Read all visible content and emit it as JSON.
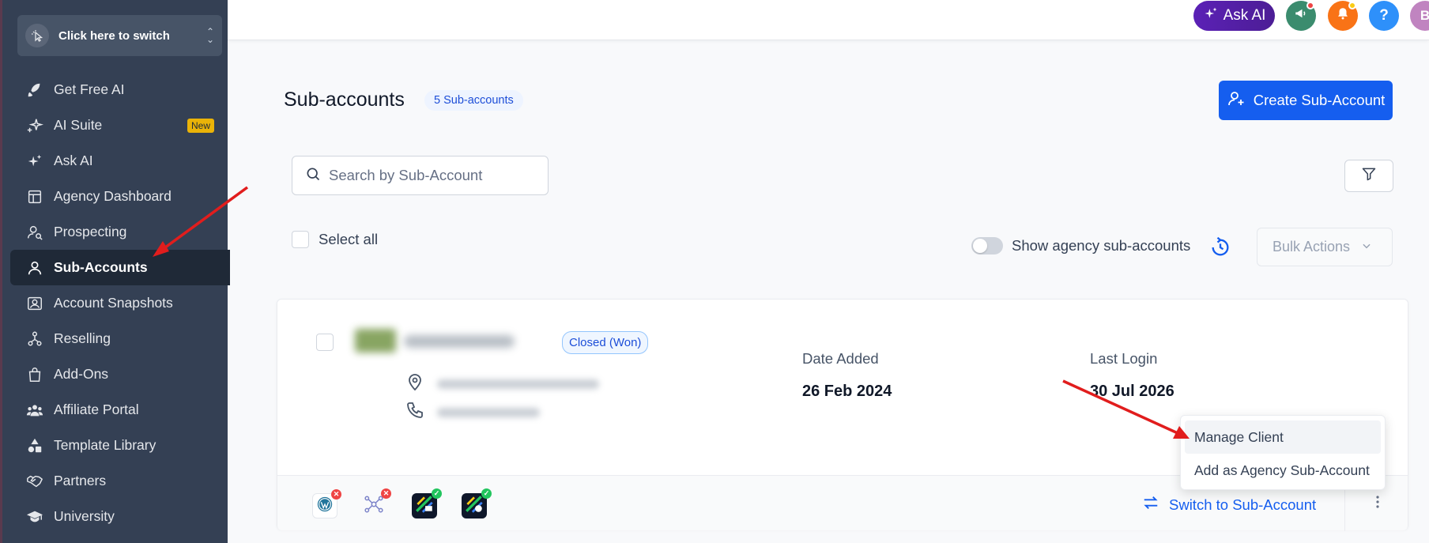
{
  "sidebar": {
    "switcher_label": "Click here to switch",
    "items": [
      {
        "label": "Get Free AI",
        "icon": "rocket-icon"
      },
      {
        "label": "AI Suite",
        "icon": "sparkle-icon",
        "badge": "New"
      },
      {
        "label": "Ask AI",
        "icon": "sparkles-icon"
      },
      {
        "label": "Agency Dashboard",
        "icon": "dashboard-icon"
      },
      {
        "label": "Prospecting",
        "icon": "user-search-icon"
      },
      {
        "label": "Sub-Accounts",
        "icon": "user-icon",
        "active": true
      },
      {
        "label": "Account Snapshots",
        "icon": "snapshot-icon"
      },
      {
        "label": "Reselling",
        "icon": "hierarchy-icon"
      },
      {
        "label": "Add-Ons",
        "icon": "bag-icon"
      },
      {
        "label": "Affiliate Portal",
        "icon": "users-icon"
      },
      {
        "label": "Template Library",
        "icon": "shapes-icon"
      },
      {
        "label": "Partners",
        "icon": "handshake-icon"
      },
      {
        "label": "University",
        "icon": "graduation-cap-icon"
      }
    ]
  },
  "topbar": {
    "ask_ai_label": "Ask AI",
    "help_label": "?",
    "avatar_initials": "B",
    "colors": {
      "ask_ai": "#4c1d95",
      "announce": "#3b8c6e",
      "bell": "#f97316",
      "help": "#2e90fa",
      "avatar": "#c084c0"
    }
  },
  "main": {
    "title": "Sub-accounts",
    "count_label": "5 Sub-accounts",
    "create_button": "Create Sub-Account",
    "search_placeholder": "Search by Sub-Account",
    "select_all_label": "Select all",
    "show_agency_label": "Show agency sub-accounts",
    "bulk_actions_label": "Bulk Actions"
  },
  "card": {
    "status": "Closed (Won)",
    "date_added_label": "Date Added",
    "date_added_value": "26 Feb 2024",
    "last_login_label": "Last Login",
    "last_login_value": "30 Jul 2026",
    "switch_label": "Switch to Sub-Account"
  },
  "dropdown": {
    "items": [
      "Manage Client",
      "Add as Agency Sub-Account"
    ]
  },
  "colors": {
    "sidebar_bg": "#344054",
    "primary": "#155eef",
    "annotation_arrow": "#e11d1d"
  }
}
